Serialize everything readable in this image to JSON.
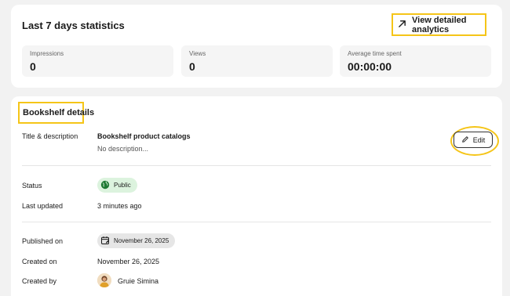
{
  "stats": {
    "title": "Last 7 days statistics",
    "analytics_button": "View detailed analytics",
    "items": [
      {
        "label": "Impressions",
        "value": "0"
      },
      {
        "label": "Views",
        "value": "0"
      },
      {
        "label": "Average time spent",
        "value": "00:00:00"
      }
    ]
  },
  "details": {
    "title": "Bookshelf details",
    "title_desc_label": "Title & description",
    "product_name": "Bookshelf product catalogs",
    "product_description": "No description...",
    "edit_button": "Edit",
    "status_label": "Status",
    "status_value": "Public",
    "last_updated_label": "Last updated",
    "last_updated_value": "3 minutes ago",
    "published_label": "Published on",
    "published_value": "November 26, 2025",
    "created_on_label": "Created on",
    "created_on_value": "November 26, 2025",
    "created_by_label": "Created by",
    "created_by_value": "Gruie Simina"
  },
  "colors": {
    "highlight": "#f5c518",
    "public_bg": "#dcf3de",
    "public_icon": "#1f7a34"
  },
  "icons": [
    "arrow-up-right-icon",
    "pencil-icon",
    "globe-icon",
    "calendar-icon",
    "avatar"
  ]
}
